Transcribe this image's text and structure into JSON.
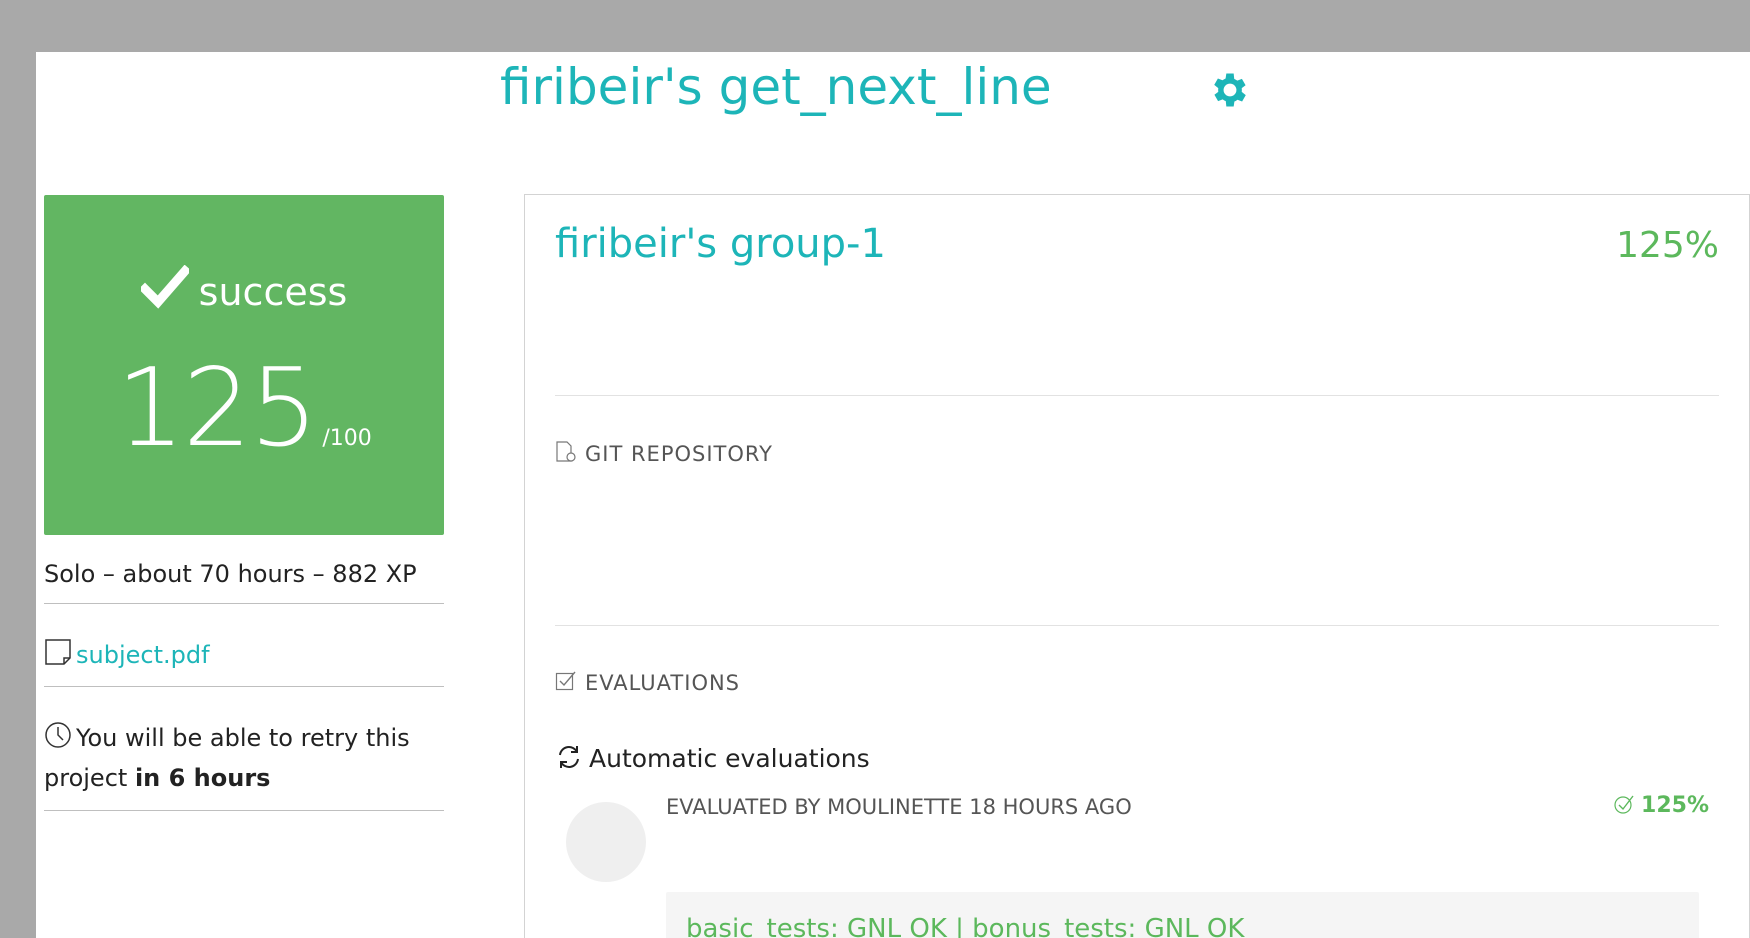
{
  "project": {
    "title": "firibeir's get_next_line"
  },
  "status_card": {
    "status": "success",
    "score": "125",
    "max": "/100",
    "color": "#62b662"
  },
  "info": {
    "summary": "Solo – about 70 hours – 882 XP"
  },
  "subject": {
    "link_label": "subject.pdf",
    "icon": "file-icon"
  },
  "retry": {
    "prefix": "You will be able to retry this project",
    "emphasis": "in 6 hours",
    "icon": "clock-icon"
  },
  "group": {
    "name": "firibeir's group-1",
    "percent": "125%"
  },
  "sections": {
    "git": "GIT REPOSITORY",
    "evaluations": "EVALUATIONS"
  },
  "automatic": {
    "label": "Automatic evaluations",
    "evaluated_by": "EVALUATED BY MOULINETTE 18 HOURS AGO",
    "score": "125%",
    "result": "basic_tests: GNL OK | bonus_tests: GNL OK"
  },
  "colors": {
    "accent": "#1db5b8",
    "success": "#5cb85c",
    "background": "#a9a9a9"
  }
}
